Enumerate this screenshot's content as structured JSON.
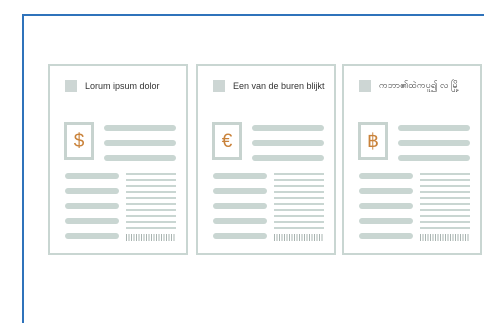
{
  "cards": [
    {
      "heading": "Lorum ipsum dolor",
      "currency_symbol": "$",
      "currency_icon": "dollar-sign-icon"
    },
    {
      "heading": "Een van de buren blijkt",
      "currency_symbol": "€",
      "currency_icon": "euro-sign-icon"
    },
    {
      "heading": "ကဘာ၏ထဲကပူ၍ လ မြို့",
      "currency_symbol": "฿",
      "currency_icon": "baht-sign-icon"
    }
  ],
  "colors": {
    "frame_accent": "#2f73bb",
    "card_border": "#c9d6d2",
    "placeholder_line": "#c9d6d2",
    "currency_symbol": "#c9823a"
  }
}
